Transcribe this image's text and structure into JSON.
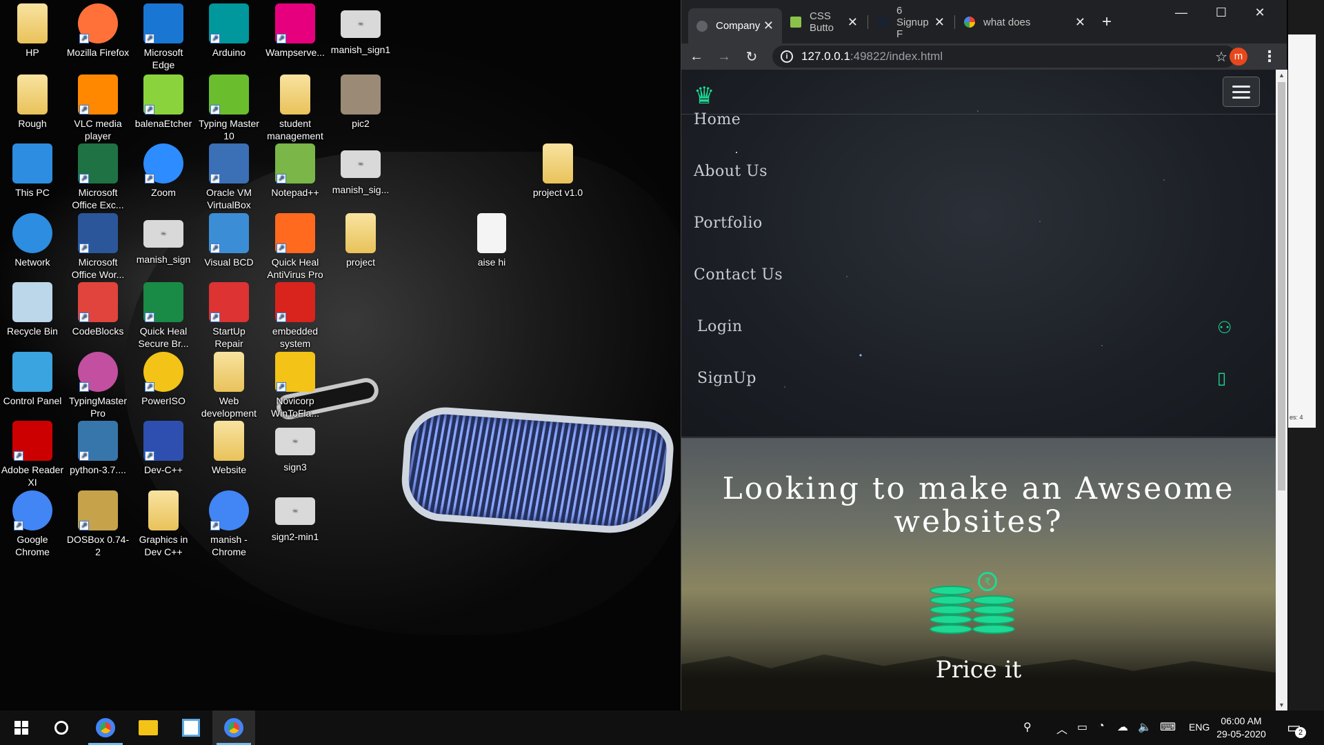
{
  "desktop": {
    "icons": [
      {
        "label": "HP",
        "icon": "user-folder-icon",
        "color": "#e8c15a"
      },
      {
        "label": "Mozilla Firefox",
        "icon": "firefox-icon",
        "color": "#ff7139"
      },
      {
        "label": "Microsoft Edge",
        "icon": "edge-icon",
        "color": "#1976d2"
      },
      {
        "label": "Arduino",
        "icon": "arduino-icon",
        "color": "#00979d"
      },
      {
        "label": "Wampserve...",
        "icon": "wampserver-icon",
        "color": "#e6007e"
      },
      {
        "label": "manish_sign1",
        "icon": "signature-image-icon",
        "color": "#d9d9d9"
      },
      {
        "label": "Rough",
        "icon": "folder-icon",
        "color": "#e9c25a"
      },
      {
        "label": "VLC media player",
        "icon": "vlc-icon",
        "color": "#ff8800"
      },
      {
        "label": "balenaEtcher",
        "icon": "etcher-icon",
        "color": "#8bd33c"
      },
      {
        "label": "Typing Master 10",
        "icon": "typing-master-icon",
        "color": "#6abe2e"
      },
      {
        "label": "student management",
        "icon": "folder-icon",
        "color": "#e9c25a"
      },
      {
        "label": "pic2",
        "icon": "photo-icon",
        "color": "#9b8a75"
      },
      {
        "label": "This PC",
        "icon": "computer-icon",
        "color": "#2d8de0"
      },
      {
        "label": "Microsoft Office Exc...",
        "icon": "excel-icon",
        "color": "#1f7244"
      },
      {
        "label": "Zoom",
        "icon": "zoom-icon",
        "color": "#2d8cff"
      },
      {
        "label": "Oracle VM VirtualBox",
        "icon": "virtualbox-icon",
        "color": "#3b6fb6"
      },
      {
        "label": "Notepad++",
        "icon": "notepad-plus-icon",
        "color": "#7ab648"
      },
      {
        "label": "manish_sig...",
        "icon": "signature-image-icon",
        "color": "#d9d9d9"
      },
      {
        "label": "project v1.0",
        "icon": "folder-icon",
        "color": "#e9c25a"
      },
      {
        "label": "Network",
        "icon": "network-icon",
        "color": "#2d8de0"
      },
      {
        "label": "Microsoft Office Wor...",
        "icon": "word-icon",
        "color": "#2b579a"
      },
      {
        "label": "manish_sign",
        "icon": "signature-image-icon",
        "color": "#d9d9d9"
      },
      {
        "label": "Visual BCD",
        "icon": "visual-bcd-icon",
        "color": "#3b8ed6"
      },
      {
        "label": "Quick Heal AntiVirus Pro",
        "icon": "quick-heal-icon",
        "color": "#ff6a1f"
      },
      {
        "label": "project",
        "icon": "folder-icon",
        "color": "#e9c25a"
      },
      {
        "label": "aise hi",
        "icon": "blank-document-icon",
        "color": "#f4f4f4"
      },
      {
        "label": "Recycle Bin",
        "icon": "recycle-bin-icon",
        "color": "#bcd6ea"
      },
      {
        "label": "CodeBlocks",
        "icon": "codeblocks-icon",
        "color": "#e0443c"
      },
      {
        "label": "Quick Heal Secure Br...",
        "icon": "secure-browser-icon",
        "color": "#1a8a47"
      },
      {
        "label": "StartUp Repair",
        "icon": "first-aid-icon",
        "color": "#d33"
      },
      {
        "label": "embedded system",
        "icon": "pdf-icon",
        "color": "#d9231d"
      },
      {
        "label": "Control Panel",
        "icon": "control-panel-icon",
        "color": "#3aa4e0"
      },
      {
        "label": "TypingMaster Pro",
        "icon": "typingmaster-pro-icon",
        "color": "#c24fa0"
      },
      {
        "label": "PowerISO",
        "icon": "poweriso-icon",
        "color": "#f3c317"
      },
      {
        "label": "Web development",
        "icon": "pdf-folder-icon",
        "color": "#e9c25a"
      },
      {
        "label": "Novicorp WinToFla...",
        "icon": "wintoflash-icon",
        "color": "#f3c317"
      },
      {
        "label": "Adobe Reader XI",
        "icon": "adobe-reader-icon",
        "color": "#cc0000"
      },
      {
        "label": "python-3.7....",
        "icon": "python-installer-icon",
        "color": "#3776ab"
      },
      {
        "label": "Dev-C++",
        "icon": "devcpp-icon",
        "color": "#2f4fb0"
      },
      {
        "label": "Website",
        "icon": "folder-icon",
        "color": "#e9c25a"
      },
      {
        "label": "sign3",
        "icon": "signature-image-icon",
        "color": "#d9d9d9"
      },
      {
        "label": "Google Chrome",
        "icon": "chrome-icon",
        "color": "#4285f4"
      },
      {
        "label": "DOSBox 0.74-2",
        "icon": "dosbox-icon",
        "color": "#c6a24b"
      },
      {
        "label": "Graphics in Dev C++",
        "icon": "folder-icon",
        "color": "#e9c25a"
      },
      {
        "label": "manish - Chrome",
        "icon": "chrome-profile-icon",
        "color": "#4285f4"
      },
      {
        "label": "sign2-min1",
        "icon": "signature-image-icon",
        "color": "#d9d9d9"
      }
    ]
  },
  "browser": {
    "tabs": [
      {
        "title": "Company",
        "active": true
      },
      {
        "title": "CSS Butto",
        "active": false
      },
      {
        "title": "6 Signup F",
        "active": false
      },
      {
        "title": "what does",
        "active": false
      }
    ],
    "address": {
      "host": "127.0.0.1",
      "path": ":49822/index.html"
    },
    "profile_initial": "m",
    "page": {
      "nav_links": [
        "Home",
        "About Us",
        "Portfolio",
        "Contact Us",
        "Login",
        "SignUp"
      ],
      "hero_title": "Looking to make an Awseome websites?",
      "section_label": "Price it",
      "accent": "#1ed993"
    }
  },
  "side_window": {
    "text": "es: 4"
  },
  "taskbar": {
    "language": "ENG",
    "time": "06:00 AM",
    "date": "29-05-2020",
    "notification_count": "2"
  }
}
